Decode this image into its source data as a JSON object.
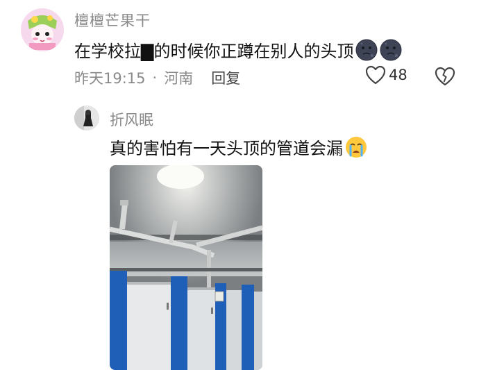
{
  "comment": {
    "username": "檀檀芒果干",
    "text": "在学校拉▇的时候你正蹲在别人的头顶",
    "emojis": [
      "moon-face-icon",
      "moon-face-icon"
    ],
    "time": "昨天19:15",
    "location": "河南",
    "separator": "·",
    "reply_label": "回复",
    "like_count": "48"
  },
  "reply": {
    "username": "折风眠",
    "text": "真的害怕有一天头顶的管道会漏",
    "emoji": "crying-face-icon"
  },
  "colors": {
    "meta_gray": "#8a8a8a",
    "text": "#111111",
    "partition_blue": "#1f5fb8",
    "door_white": "#e9ecef",
    "avatar_pink": "#f6d8ec"
  }
}
